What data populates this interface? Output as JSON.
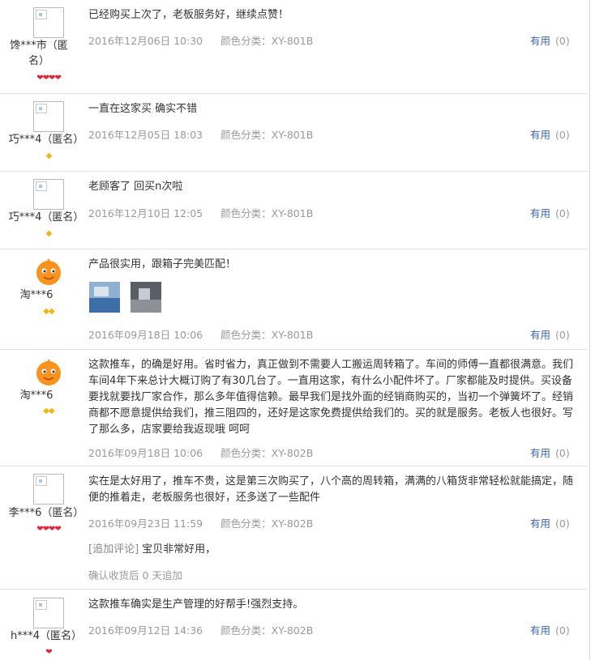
{
  "reviews": [
    {
      "user": "馋***市（匿名）",
      "rank": "❤❤❤❤",
      "text": "已经购买上次了，老板服务好，继续点赞！",
      "date": "2016年12月06日 10:30",
      "category": "颜色分类：XY-801B",
      "useful_label": "有用",
      "useful_count": "(0)"
    },
    {
      "user": "巧***4（匿名）",
      "rank": "◆",
      "text": "一直在这家买 确实不错",
      "date": "2016年12月05日 18:03",
      "category": "颜色分类：XY-801B",
      "useful_label": "有用",
      "useful_count": "(0)"
    },
    {
      "user": "巧***4（匿名）",
      "rank": "◆",
      "text": "老顾客了 回买n次啦",
      "date": "2016年12月10日 12:05",
      "category": "颜色分类：XY-801B",
      "useful_label": "有用",
      "useful_count": "(0)"
    },
    {
      "user": "淘***6",
      "rank": "◆◆",
      "text": "产品很实用，跟箱子完美匹配！",
      "date": "2016年09月18日 10:06",
      "category": "颜色分类：XY-801B",
      "useful_label": "有用",
      "useful_count": "(0)"
    },
    {
      "user": "淘***6",
      "rank": "◆◆",
      "text": "这款推车，的确是好用。省时省力，真正做到不需要人工搬运周转箱了。车间的师傅一直都很满意。我们车间4年下来总计大概订购了有30几台了。一直用这家，有什么小配件坏了。厂家都能及时提供。买设备要找就要找厂家合作，那么多年值得信赖。最早我们是找外面的经销商购买的，当初一个弹簧坏了。经销商都不愿意提供给我们，推三阻四的，还好是这家免费提供给我们的。买的就是服务。老板人也很好。写了那么多，店家要给我返现哦 呵呵",
      "date": "2016年09月18日 10:06",
      "category": "颜色分类：XY-802B",
      "useful_label": "有用",
      "useful_count": "(0)"
    },
    {
      "user": "李***6（匿名）",
      "rank": "❤❤❤❤",
      "text": "实在是太好用了，推车不贵，这是第三次购买了，八个高的周转箱，满满的八箱货非常轻松就能搞定，随便的推着走，老板服务也很好，还多送了一些配件",
      "date": "2016年09月23日 11:59",
      "category": "颜色分类：XY-802B",
      "useful_label": "有用",
      "useful_count": "(0)",
      "additional_label": "[追加评论]",
      "additional_text": "宝贝非常好用，",
      "confirm_note": "确认收货后 0 天追加"
    },
    {
      "user": "h***4（匿名）",
      "rank": "❤",
      "text": "这款推车确实是生产管理的好帮手!强烈支持。",
      "date": "2016年09月12日 14:36",
      "category": "颜色分类：XY-802B",
      "useful_label": "有用",
      "useful_count": "(0)"
    }
  ],
  "colors": {
    "link_blue": "#3a66b0",
    "meta_gray": "#999999",
    "rank_red": "#e0263a",
    "rank_gold": "#f3b313",
    "mascot_orange": "#f7931e"
  }
}
